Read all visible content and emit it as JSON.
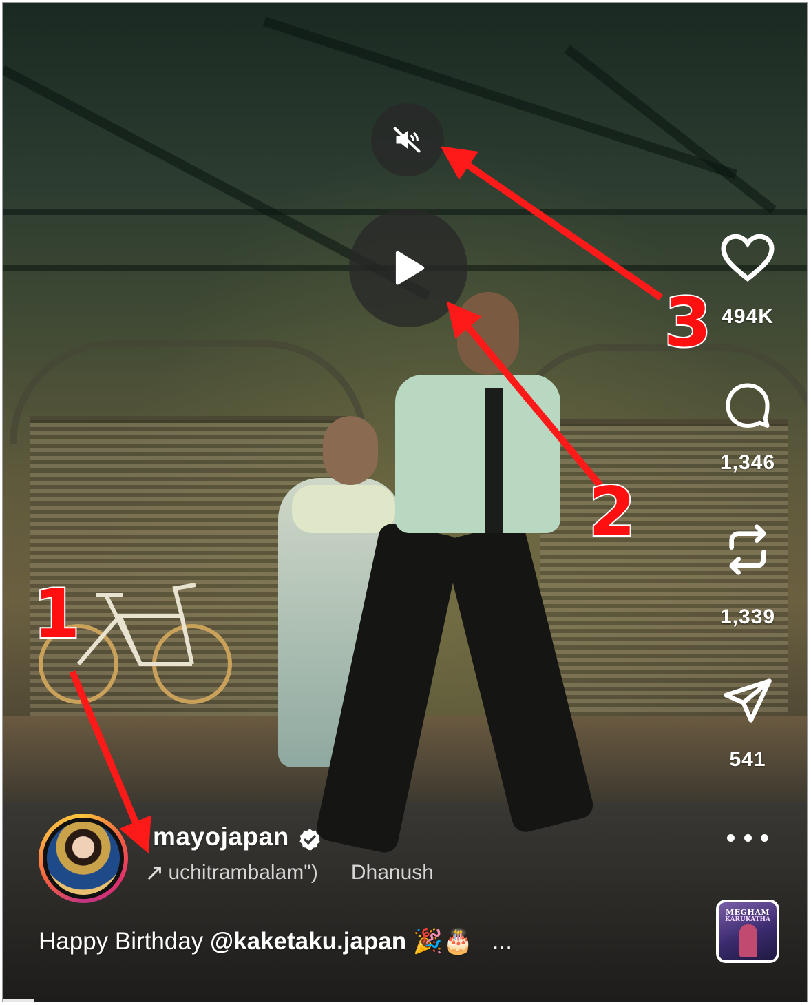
{
  "reel": {
    "username": "mayojapan",
    "audio_title": "uchitrambalam\")",
    "audio_artist": "Dhanush",
    "caption_text": "Happy Birthday ",
    "caption_mention": "@kaketaku.japan",
    "caption_emoji": "🎉🎂",
    "caption_more": "...",
    "audio_art_title": "MEGHAM",
    "audio_art_subtitle": "KARUKATHA"
  },
  "actions": {
    "likes": "494K",
    "comments": "1,346",
    "reposts": "1,339",
    "shares": "541"
  },
  "annotations": {
    "label_1": "1",
    "label_2": "2",
    "label_3": "3",
    "arrow_color": "#ff1a1a"
  },
  "icons": {
    "mute": "muted-speaker-icon",
    "play": "play-icon",
    "like": "heart-icon",
    "comment": "comment-bubble-icon",
    "repost": "repost-icon",
    "share": "paper-plane-icon",
    "more": "more-dots-icon",
    "verified": "verified-badge-icon",
    "audio": "audio-arrow-icon"
  }
}
